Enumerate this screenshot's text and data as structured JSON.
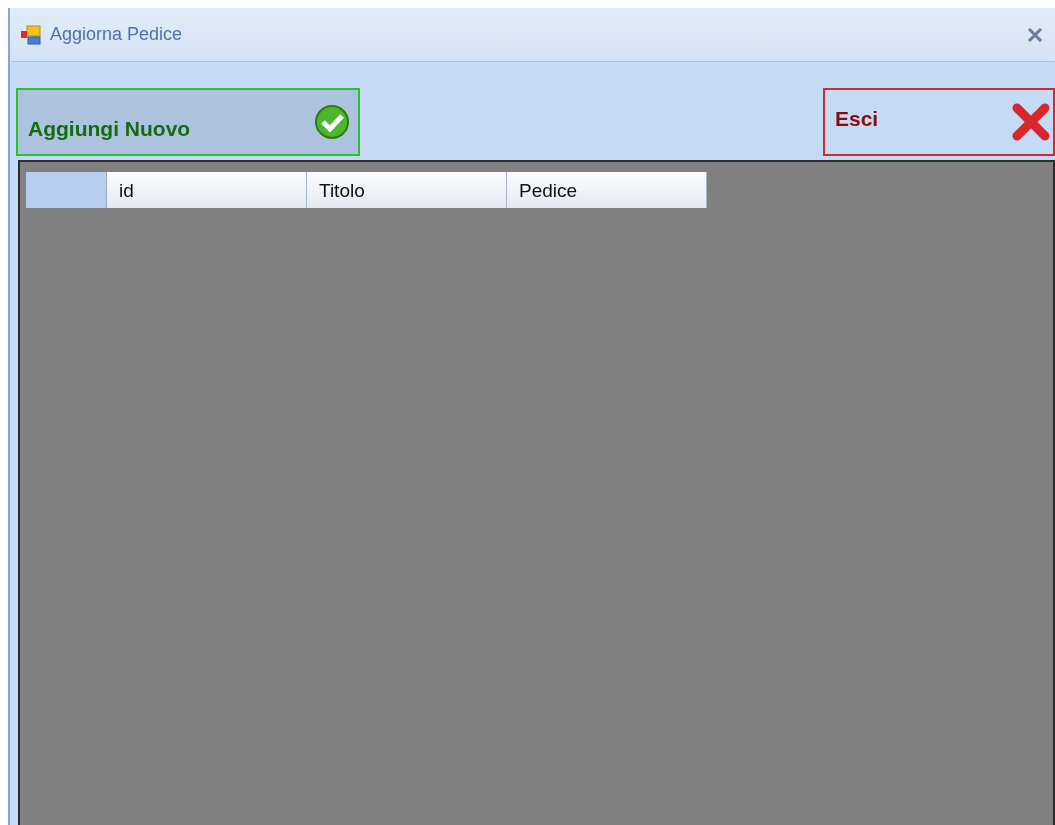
{
  "window": {
    "title": "Aggiorna Pedice"
  },
  "buttons": [
    {
      "label": "Aggiungi Nuovo",
      "kind": "add"
    },
    {
      "label": "Esci",
      "kind": "exit"
    }
  ],
  "table": {
    "columns": [
      "id",
      "Titolo",
      "Pedice"
    ]
  }
}
